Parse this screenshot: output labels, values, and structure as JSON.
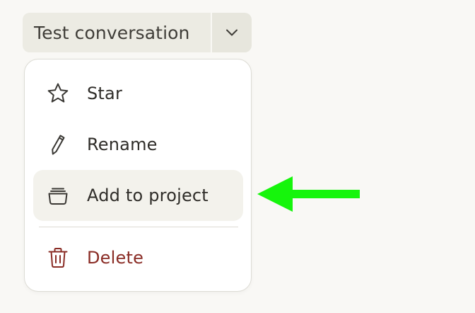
{
  "conversation": {
    "title": "Test conversation"
  },
  "menu": {
    "items": [
      {
        "label": "Star",
        "icon": "star-icon"
      },
      {
        "label": "Rename",
        "icon": "pencil-icon"
      },
      {
        "label": "Add to project",
        "icon": "project-box-icon",
        "highlighted": true
      },
      {
        "label": "Delete",
        "icon": "trash-icon",
        "danger": true
      }
    ]
  },
  "colors": {
    "background": "#f9f8f5",
    "danger": "#8a2c25",
    "annotation_arrow": "#16f50c"
  }
}
